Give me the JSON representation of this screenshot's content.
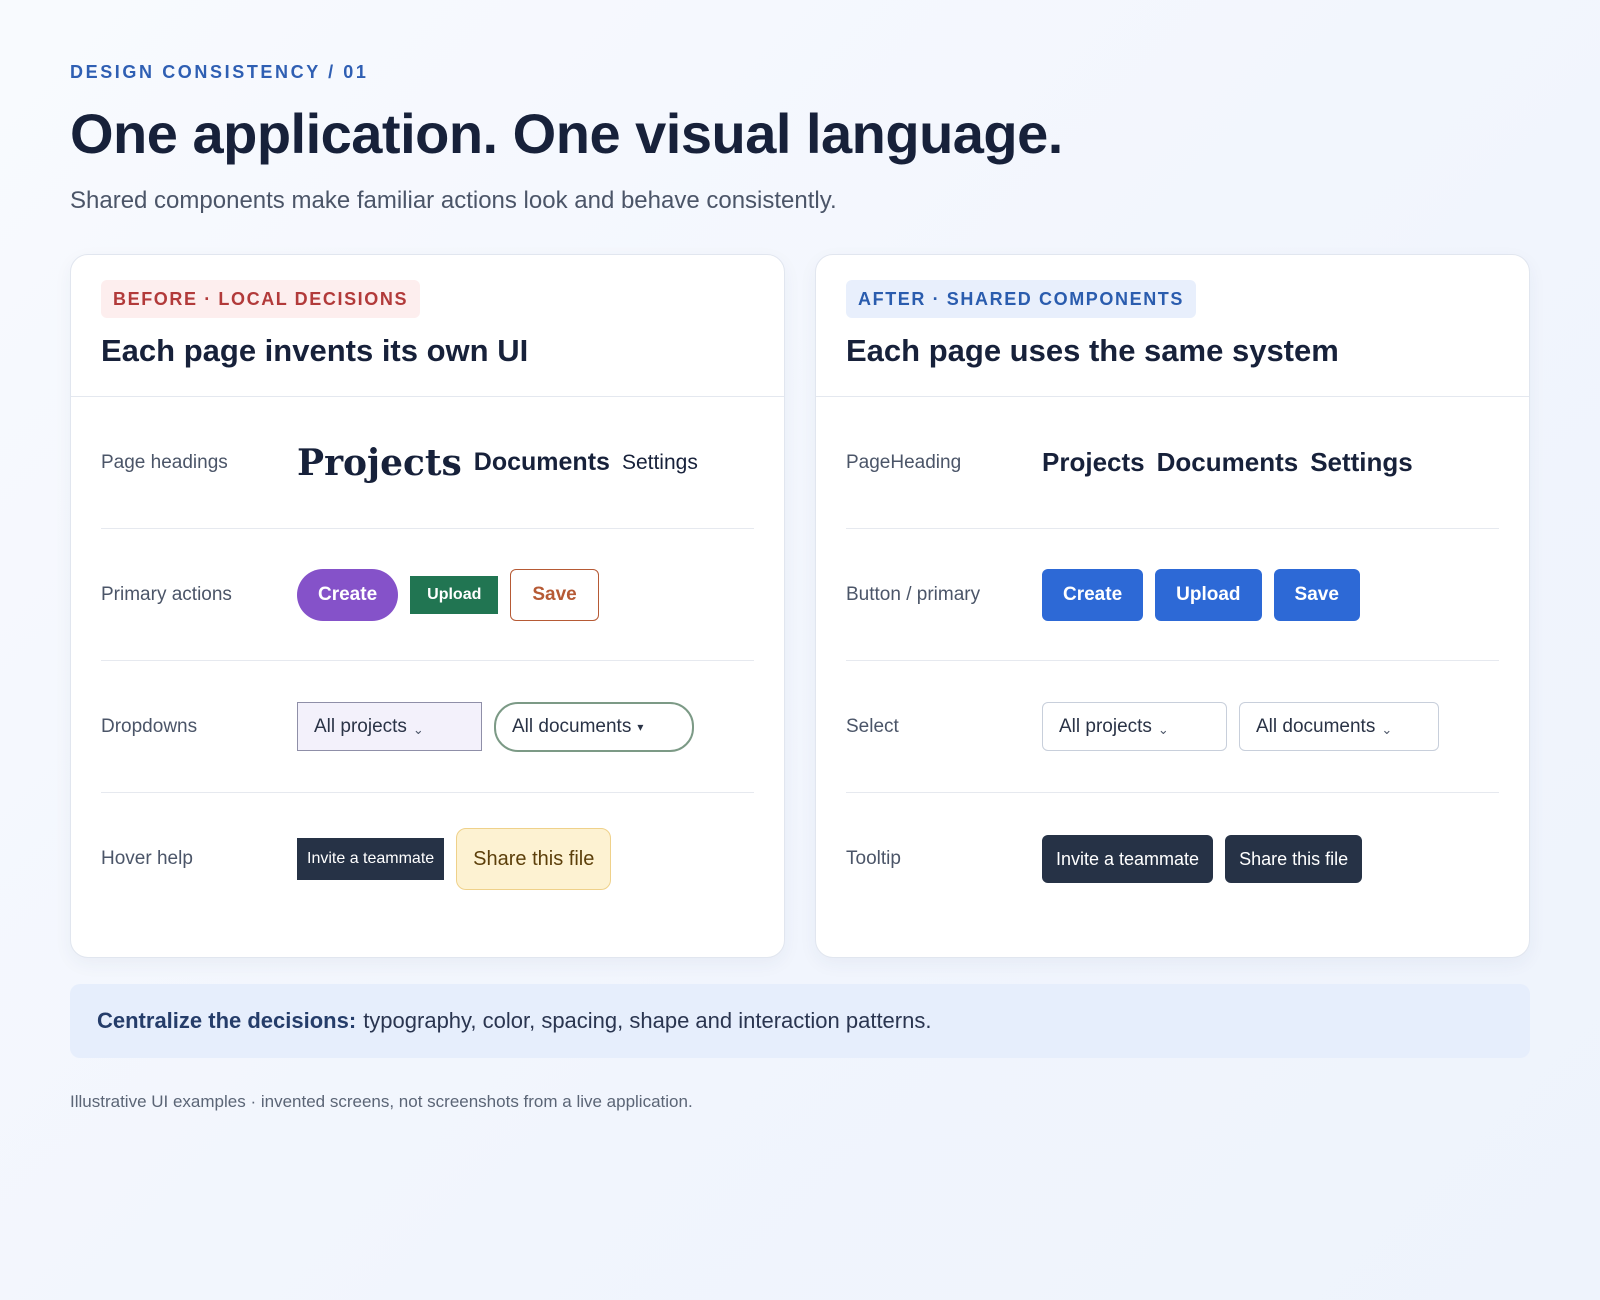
{
  "header": {
    "eyebrow": "DESIGN CONSISTENCY / 01",
    "title": "One application. One visual language.",
    "subtitle": "Shared components make familiar actions look and behave consistently."
  },
  "before": {
    "badge": "BEFORE · LOCAL DECISIONS",
    "title": "Each page invents its own UI",
    "rows": [
      {
        "label": "Page headings",
        "items": [
          "Projects",
          "Documents",
          "Settings"
        ]
      },
      {
        "label": "Primary actions",
        "items": [
          "Create",
          "Upload",
          "Save"
        ]
      },
      {
        "label": "Dropdowns",
        "items": [
          "All projects",
          "All documents"
        ]
      },
      {
        "label": "Hover help",
        "items": [
          "Invite a teammate",
          "Share this file"
        ]
      }
    ]
  },
  "after": {
    "badge": "AFTER · SHARED COMPONENTS",
    "title": "Each page uses the same system",
    "rows": [
      {
        "label": "PageHeading",
        "items": [
          "Projects",
          "Documents",
          "Settings"
        ]
      },
      {
        "label": "Button / primary",
        "items": [
          "Create",
          "Upload",
          "Save"
        ]
      },
      {
        "label": "Select",
        "items": [
          "All projects",
          "All documents"
        ]
      },
      {
        "label": "Tooltip",
        "items": [
          "Invite a teammate",
          "Share this file"
        ]
      }
    ]
  },
  "callout": {
    "strong": "Centralize the decisions:",
    "text": "typography, color, spacing, shape and interaction patterns."
  },
  "footnote": "Illustrative UI examples · invented screens, not screenshots from a live application.",
  "icons": {
    "chevron_small": "⌄",
    "caret_triangle": "▾"
  },
  "colors": {
    "accent": "#2d69d6",
    "before_badge": "#b23a3a",
    "after_badge": "#2a5cae"
  }
}
